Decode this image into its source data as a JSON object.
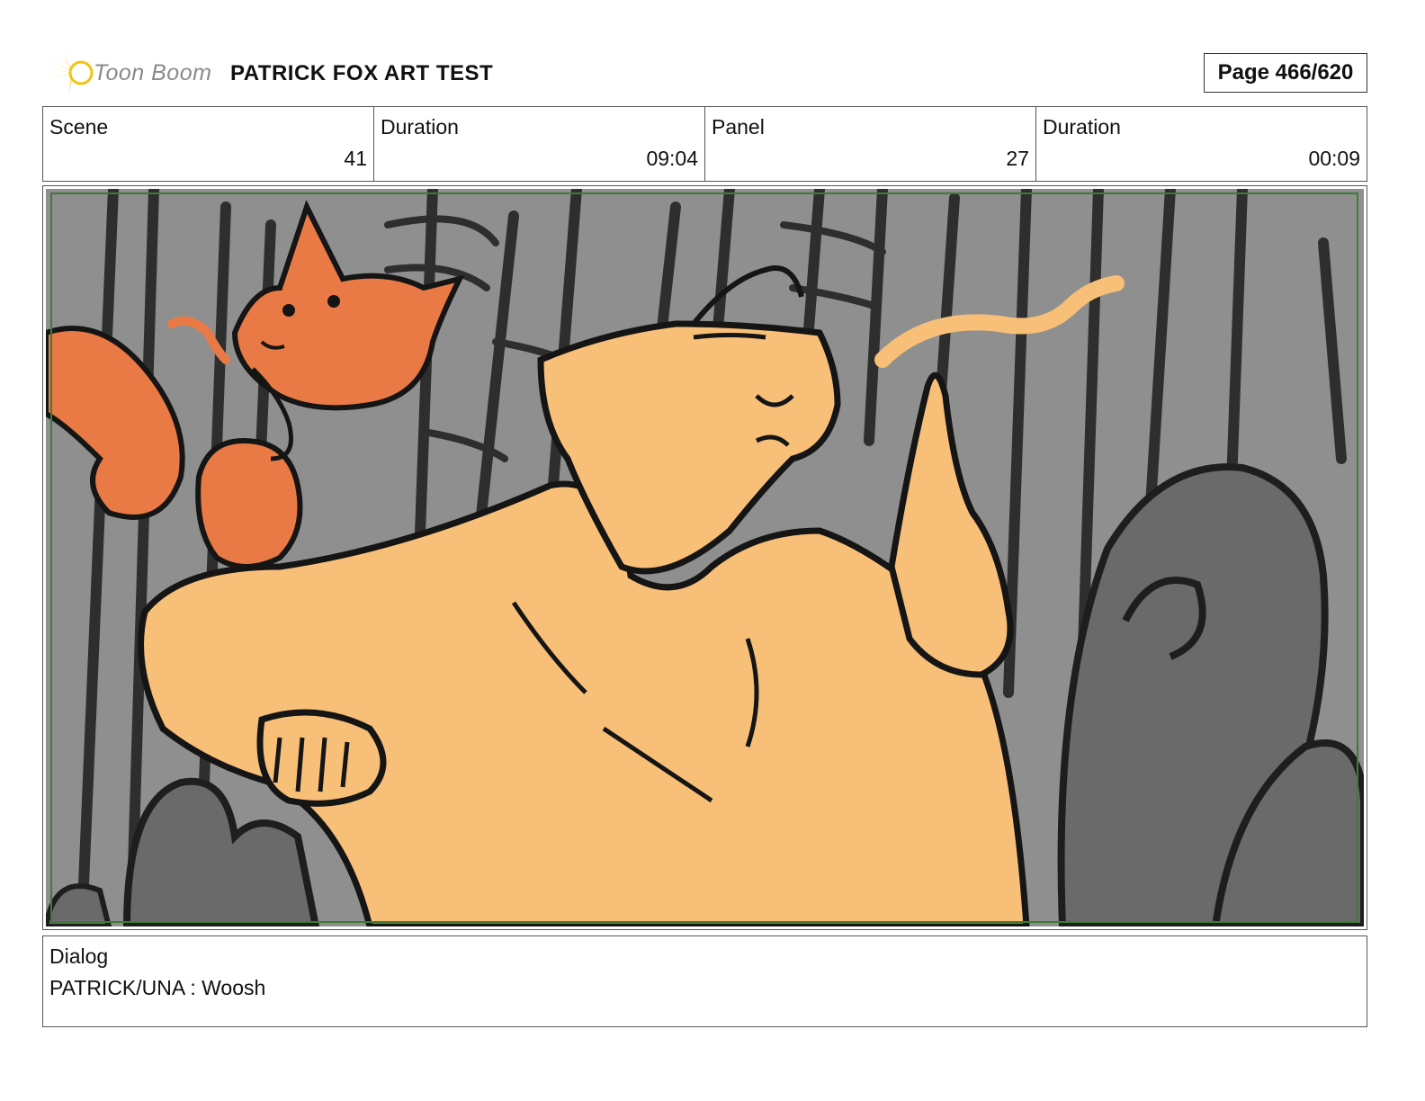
{
  "header": {
    "logo_text": "Toon Boom",
    "project_title": "PATRICK FOX ART TEST",
    "page": "Page 466/620"
  },
  "meta": {
    "scene_label": "Scene",
    "scene_value": "41",
    "scene_duration_label": "Duration",
    "scene_duration_value": "09:04",
    "panel_label": "Panel",
    "panel_value": "27",
    "panel_duration_label": "Duration",
    "panel_duration_value": "00:09"
  },
  "dialog": {
    "label": "Dialog",
    "text": "PATRICK/UNA : Woosh"
  },
  "colors": {
    "background_gray": "#8f8f8f",
    "bars_dark": "#3a3a3a",
    "character_skin": "#f8bf78",
    "fox_orange": "#e97a45",
    "bushes": "#6b6b6b",
    "safe_frame": "#3f7a36",
    "logo_burst": "#f3c316"
  }
}
